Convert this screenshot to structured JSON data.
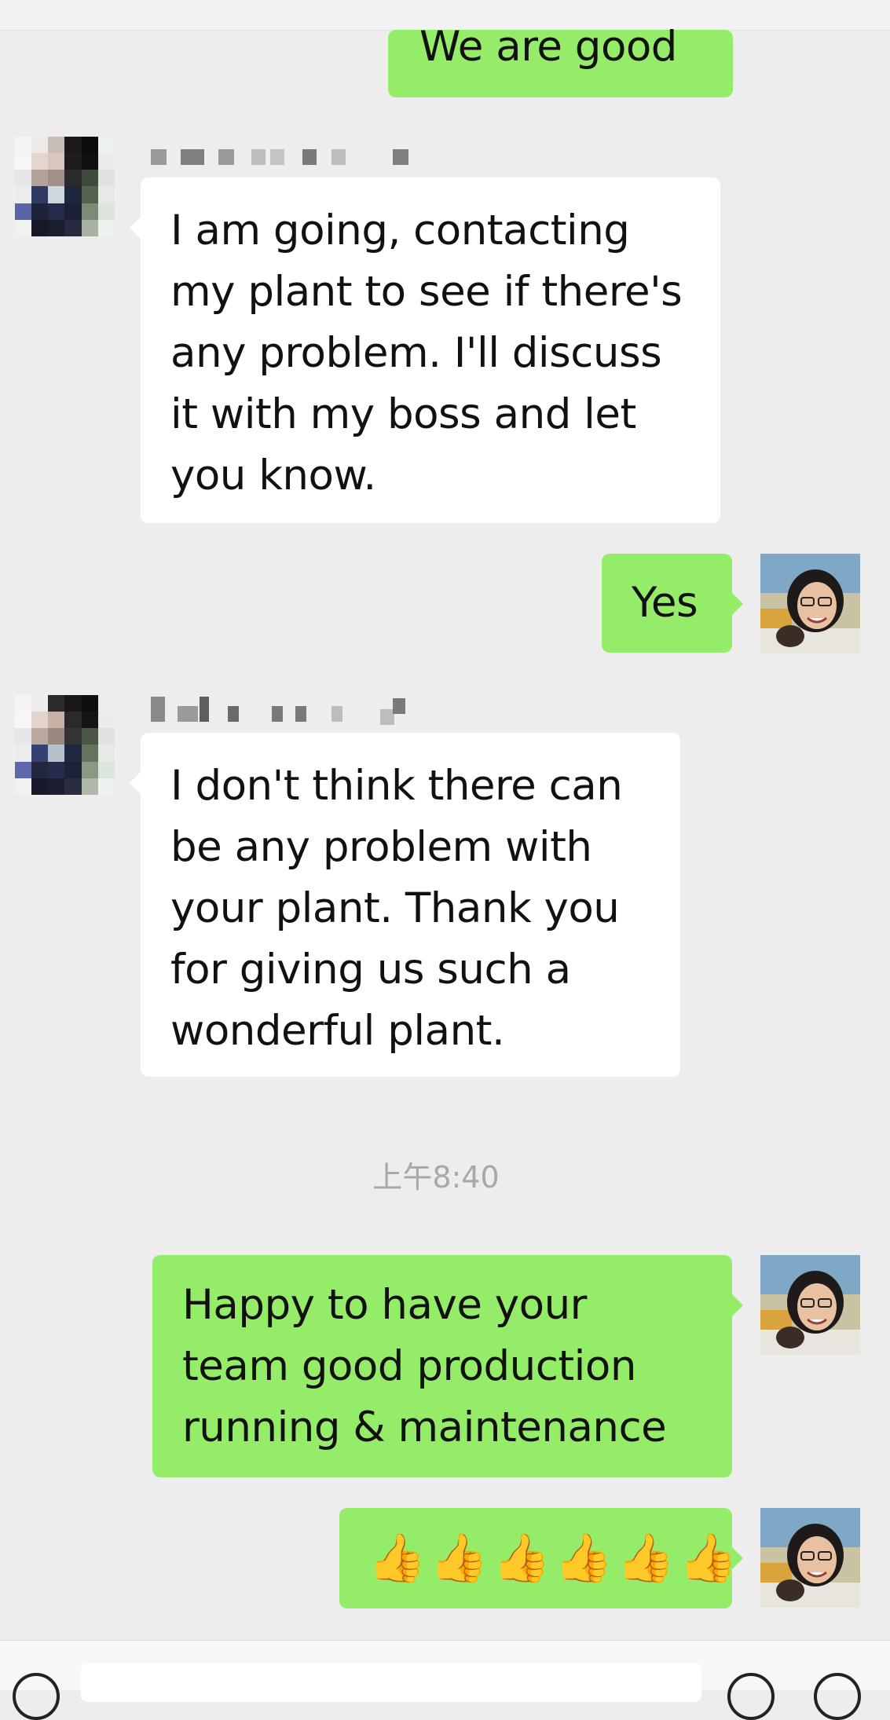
{
  "messages": [
    {
      "id": "m1",
      "side": "right",
      "text": "We are good"
    },
    {
      "id": "m2",
      "side": "left",
      "text": "I am going, contacting my plant to see if there's any problem. I'll discuss it with my boss and let you know."
    },
    {
      "id": "m3",
      "side": "right",
      "text": "Yes"
    },
    {
      "id": "m4",
      "side": "left",
      "text": "I don't think there can be any problem with your plant. Thank you for giving us such a wonderful plant."
    },
    {
      "id": "m5",
      "side": "right",
      "text": "Happy to have your team good production running & maintenance"
    },
    {
      "id": "m6",
      "side": "right",
      "emoji": [
        "👍",
        "👍",
        "👍",
        "👍",
        "👍",
        "👍"
      ]
    }
  ],
  "m1_text": "We are good",
  "m2_lines": [
    "I am going, contacting",
    "my plant to see if there's",
    "any problem. I'll discuss",
    "it with my boss and let",
    "you know."
  ],
  "m3_text": "Yes",
  "m4_lines": [
    "I don't think there can",
    "be any problem with",
    "your plant. Thank you",
    "for giving us such a",
    "wonderful plant."
  ],
  "m5_lines": [
    "Happy to have your",
    "team good production",
    "running & maintenance"
  ],
  "m6_emoji": [
    "👍",
    "👍",
    "👍",
    "👍",
    "👍",
    "👍"
  ],
  "timestamp": "上午8:40",
  "colors": {
    "background": "#ededed",
    "outgoing_bubble": "#95ec69",
    "incoming_bubble": "#ffffff",
    "timestamp": "#a8a8a8"
  },
  "icons": [
    "contact-avatar",
    "own-avatar",
    "voice-icon",
    "emoji-icon",
    "plus-icon"
  ]
}
